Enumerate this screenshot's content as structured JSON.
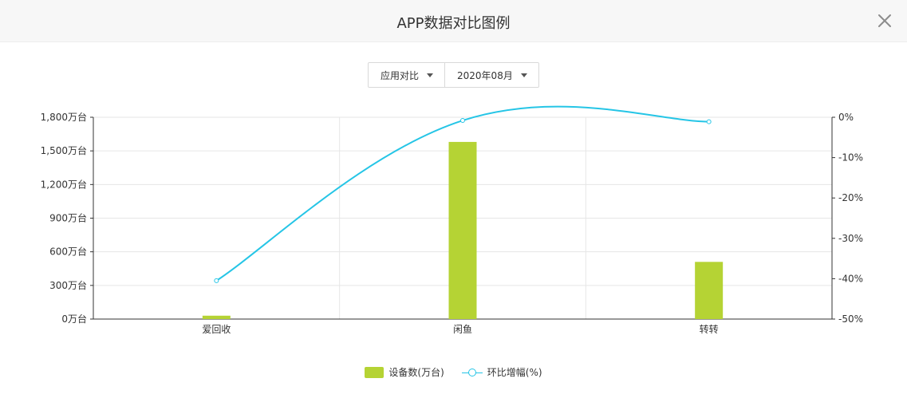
{
  "header": {
    "title": "APP数据对比图例"
  },
  "filters": {
    "compare_label": "应用对比",
    "month_label": "2020年08月"
  },
  "colors": {
    "bar": "#b5d334",
    "line": "#25c5e6",
    "grid": "#e6e6e6",
    "axis": "#333333"
  },
  "chart_data": {
    "type": "bar",
    "categories": [
      "爱回收",
      "闲鱼",
      "转转"
    ],
    "series": [
      {
        "name": "设备数(万台)",
        "type": "bar",
        "axis": "left",
        "values": [
          30,
          1580,
          510
        ]
      },
      {
        "name": "环比增幅(%)",
        "type": "line",
        "axis": "right",
        "values": [
          -40.5,
          -0.8,
          -1.1
        ]
      }
    ],
    "y_left": {
      "min": 0,
      "max": 1800,
      "ticks": [
        0,
        300,
        600,
        900,
        1200,
        1500,
        1800
      ],
      "tick_labels": [
        "0万台",
        "300万台",
        "600万台",
        "900万台",
        "1,200万台",
        "1,500万台",
        "1,800万台"
      ]
    },
    "y_right": {
      "min": -50,
      "max": 0,
      "ticks": [
        -50,
        -40,
        -30,
        -20,
        -10,
        0
      ],
      "tick_labels": [
        "-50%",
        "-40%",
        "-30%",
        "-20%",
        "-10%",
        "0%"
      ]
    },
    "grid": true,
    "legend": "bottom-center"
  }
}
